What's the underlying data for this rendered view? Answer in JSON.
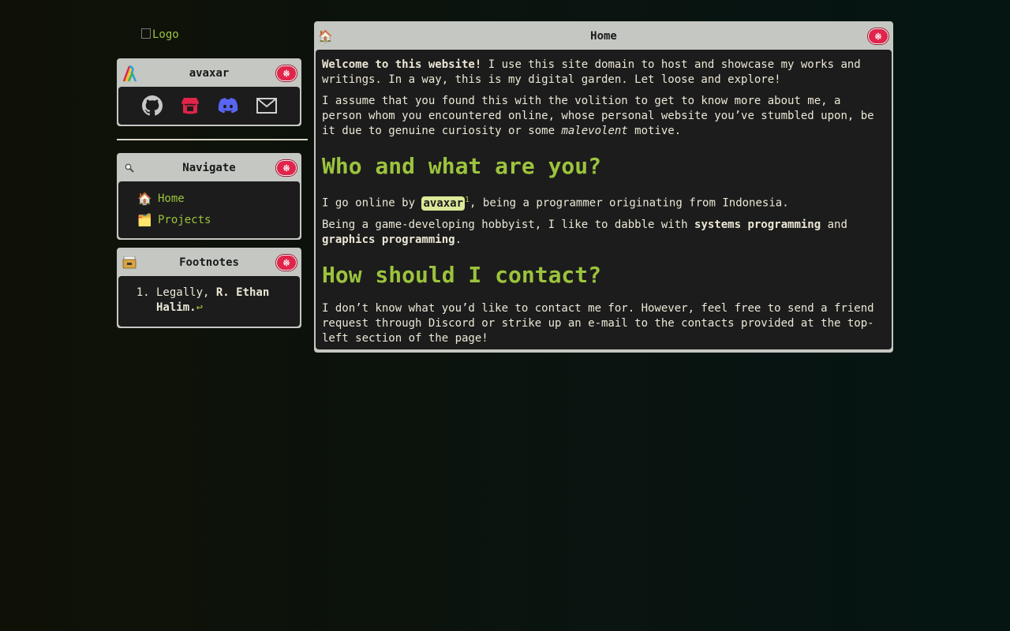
{
  "logo": {
    "alt": "Logo"
  },
  "profile_window": {
    "title": "avaxar",
    "social_icons": [
      "github-icon",
      "itch-io-icon",
      "discord-icon",
      "mail-icon"
    ],
    "colors": {
      "github": "#c8c8c8",
      "itch": "#e0244a",
      "discord": "#5865f2",
      "mail": "#d0d0d0"
    }
  },
  "navigate_window": {
    "title": "Navigate",
    "items": [
      {
        "icon": "🏠",
        "label": "Home"
      },
      {
        "icon": "🗂️",
        "label": "Projects"
      }
    ]
  },
  "footnotes_window": {
    "title": "Footnotes",
    "items": [
      {
        "prefix": "Legally, ",
        "name": "R. Ethan Halim",
        "suffix": ".",
        "back": "↩"
      }
    ]
  },
  "main_window": {
    "title": "Home",
    "p1_bold": "Welcome to this website!",
    "p1_rest": " I use this site domain to host and showcase my works and writings. In a way, this is my digital garden. Let loose and explore!",
    "p2_start": "I assume that you found this with the volition to get to know more about me, a person whom you encountered online, whose personal website you’ve stumbled upon, be it due to genuine curiosity or some ",
    "p2_em": "malevolent",
    "p2_end": " motive.",
    "h1": "Who and what are you?",
    "p3_start": "I go online by ",
    "p3_tag": "avaxar",
    "p3_sup": "1",
    "p3_end": ", being a programmer originating from Indonesia.",
    "p4_start": "Being a game-developing hobbyist, I like to dabble with ",
    "p4_b1": "systems programming",
    "p4_mid": " and ",
    "p4_b2": "graphics programming",
    "p4_end": ".",
    "h2": "How should I contact?",
    "p5": "I don’t know what you’d like to contact me for. However, feel free to send a friend request through Discord or strike up an e-mail to the contacts provided at the top-left section of the page!"
  },
  "close_button_glyph": "※",
  "accent_color": "#9cc33d"
}
